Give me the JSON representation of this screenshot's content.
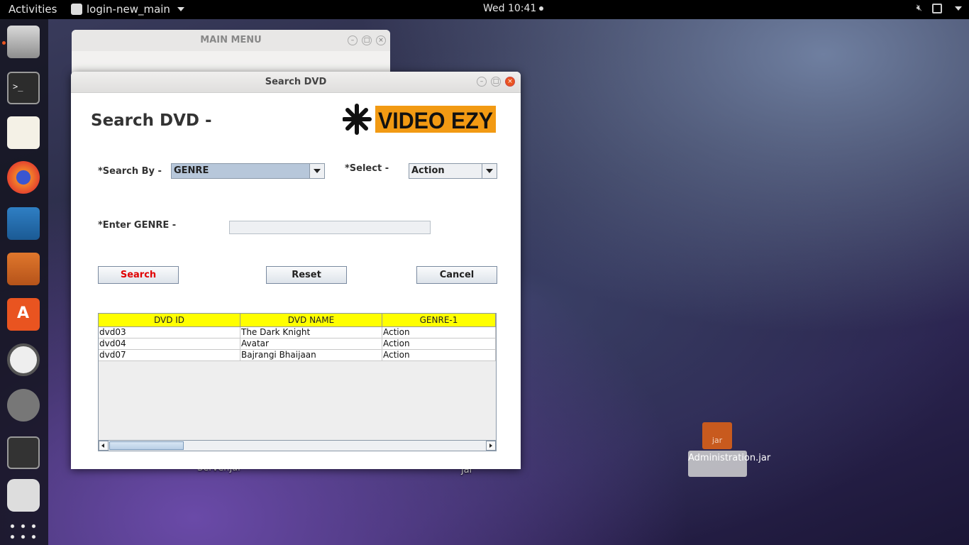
{
  "topbar": {
    "activities": "Activities",
    "app_name": "login-new_main",
    "clock": "Wed 10:41"
  },
  "dock": {
    "items": [
      "files-icon",
      "terminal-icon",
      "text-editor-icon",
      "firefox-icon",
      "writer-icon",
      "impress-icon",
      "software-center-icon",
      "software-updater-icon",
      "settings-icon",
      "system-monitor-icon",
      "remote-icon",
      "app-grid-icon"
    ]
  },
  "desktop": {
    "icons": [
      {
        "label": "Server.jar"
      },
      {
        "label": "jar"
      },
      {
        "label": "Administration.jar",
        "badge": "jar"
      }
    ]
  },
  "main_menu_window": {
    "title": "MAIN MENU"
  },
  "search_window": {
    "title": "Search DVD",
    "heading": "Search DVD -",
    "logo_text": "VIDEO EZY",
    "search_by_label": "*Search By -",
    "search_by_value": "GENRE",
    "select_label": "*Select -",
    "select_value": "Action",
    "enter_label": "*Enter GENRE -",
    "enter_value": "",
    "buttons": {
      "search": "Search",
      "reset": "Reset",
      "cancel": "Cancel"
    },
    "table": {
      "columns": [
        "DVD ID",
        "DVD NAME",
        "GENRE-1"
      ],
      "rows": [
        [
          "dvd03",
          "The Dark Knight",
          "Action"
        ],
        [
          "dvd04",
          "Avatar",
          "Action"
        ],
        [
          "dvd07",
          "Bajrangi Bhaijaan",
          "Action"
        ]
      ]
    }
  },
  "colors": {
    "accent": "#e95420",
    "table_header": "#ffff00",
    "search_text": "#e00000"
  }
}
